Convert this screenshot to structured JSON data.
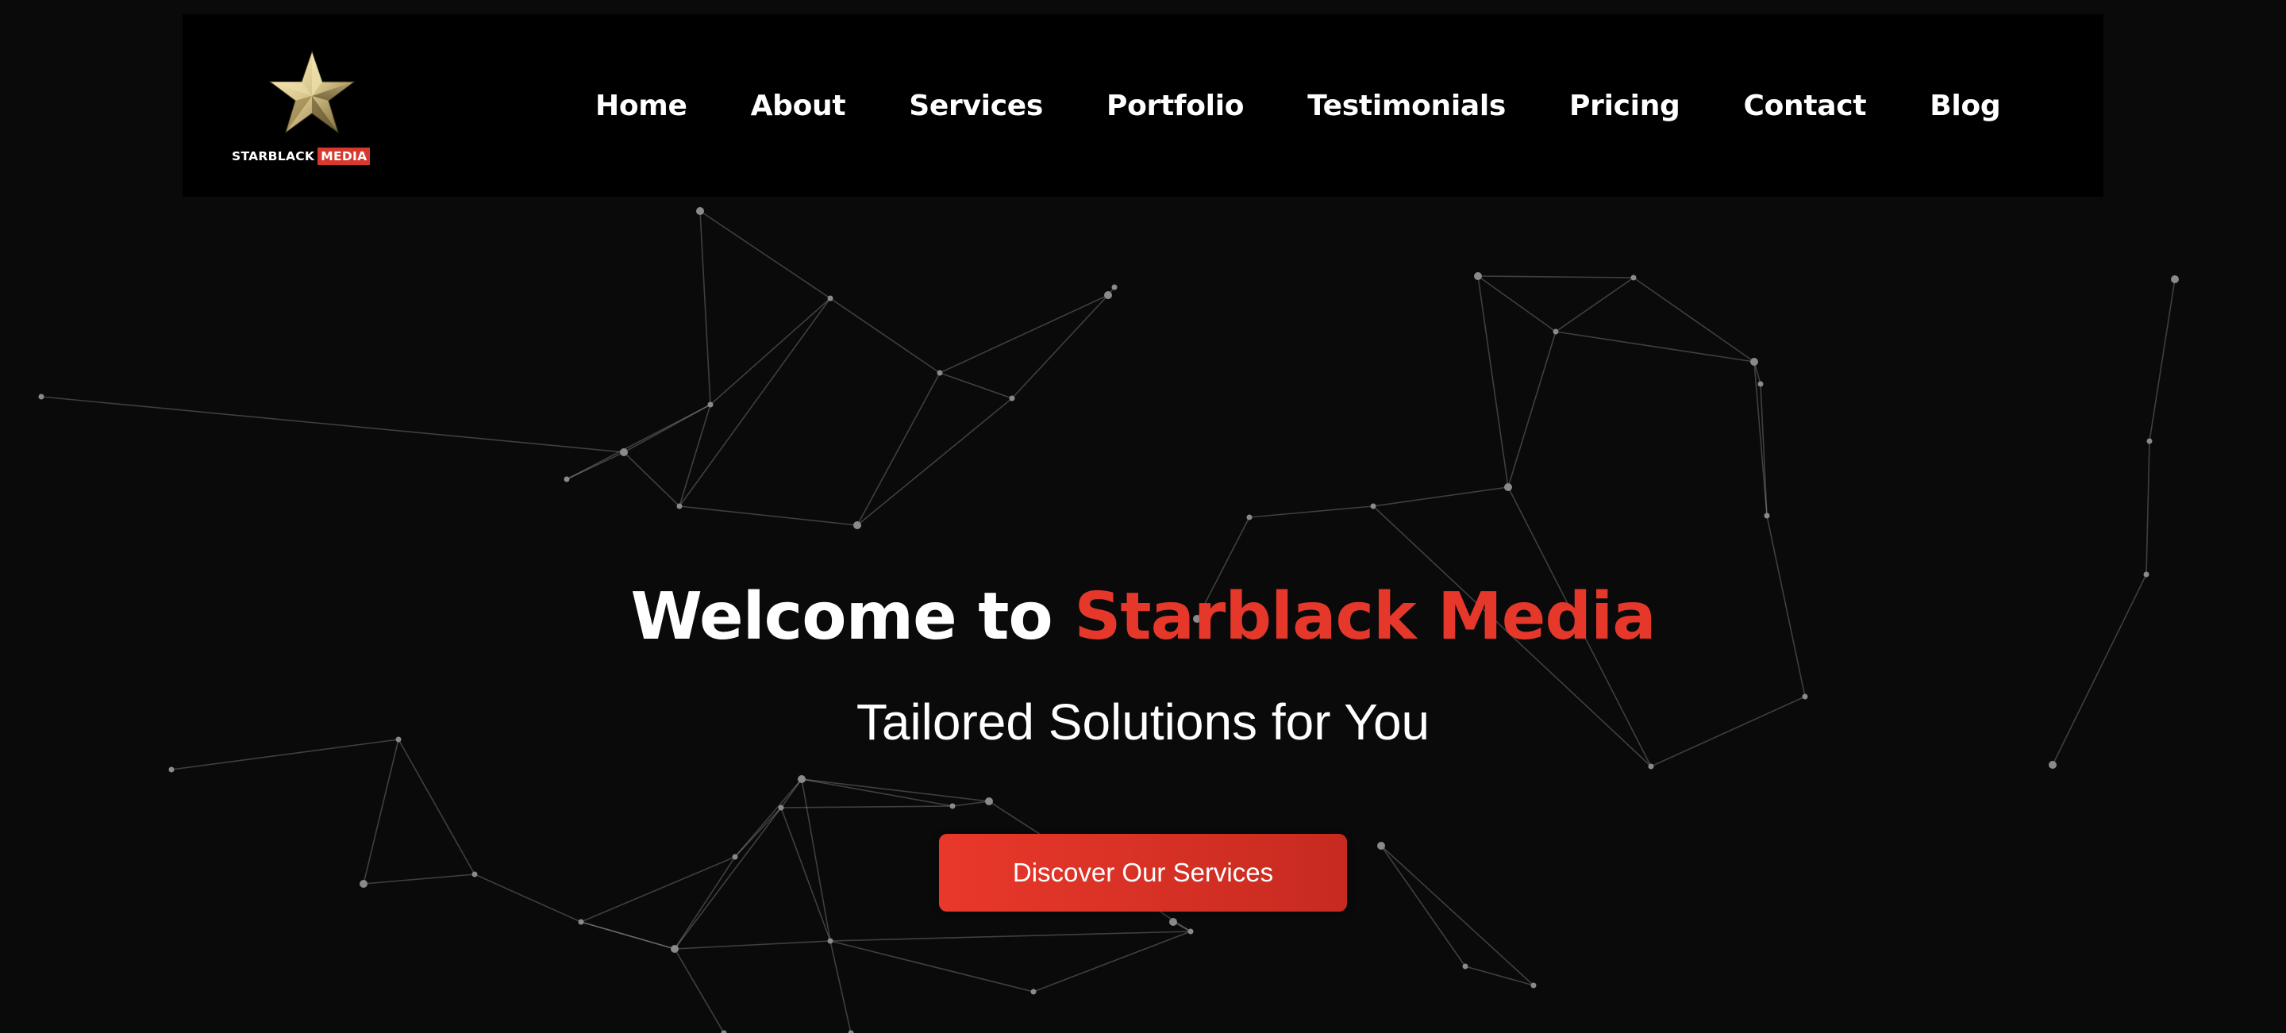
{
  "brand": {
    "name_main": "STARBLACK",
    "name_accent": "MEDIA",
    "accent_color": "#e5382b",
    "logo_icon": "gold-star-icon"
  },
  "nav": {
    "items": [
      {
        "label": "Home"
      },
      {
        "label": "About"
      },
      {
        "label": "Services"
      },
      {
        "label": "Portfolio"
      },
      {
        "label": "Testimonials"
      },
      {
        "label": "Pricing"
      },
      {
        "label": "Contact"
      },
      {
        "label": "Blog"
      }
    ]
  },
  "hero": {
    "title_prefix": "Welcome to ",
    "title_accent": "Starblack Media",
    "subtitle": "Tailored Solutions for You",
    "cta_label": "Discover Our Services"
  },
  "colors": {
    "background": "#0a0a0a",
    "header_background": "#000000",
    "button_start": "#e9382b",
    "button_end": "#c72a20"
  }
}
